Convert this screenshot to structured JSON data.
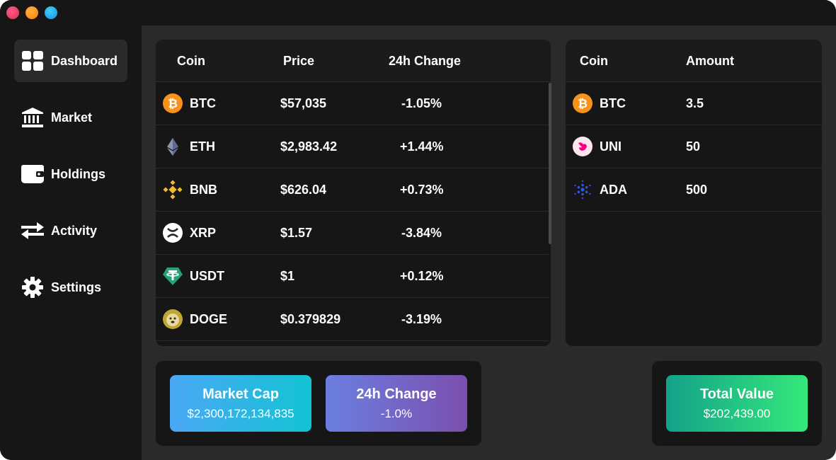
{
  "sidebar": {
    "items": [
      {
        "label": "Dashboard",
        "icon": "dashboard-grid-icon",
        "active": true
      },
      {
        "label": "Market",
        "icon": "bank-icon",
        "active": false
      },
      {
        "label": "Holdings",
        "icon": "wallet-icon",
        "active": false
      },
      {
        "label": "Activity",
        "icon": "swap-arrows-icon",
        "active": false
      },
      {
        "label": "Settings",
        "icon": "gear-icon",
        "active": false
      }
    ]
  },
  "market_table": {
    "headers": {
      "coin": "Coin",
      "price": "Price",
      "change": "24h Change"
    },
    "rows": [
      {
        "symbol": "BTC",
        "price": "$57,035",
        "change": "-1.05%",
        "icon": "bitcoin-icon",
        "color": "#f7931a"
      },
      {
        "symbol": "ETH",
        "price": "$2,983.42",
        "change": "+1.44%",
        "icon": "ethereum-icon",
        "color": "#627eea"
      },
      {
        "symbol": "BNB",
        "price": "$626.04",
        "change": "+0.73%",
        "icon": "bnb-icon",
        "color": "#f3ba2f"
      },
      {
        "symbol": "XRP",
        "price": "$1.57",
        "change": "-3.84%",
        "icon": "xrp-icon",
        "color": "#ffffff"
      },
      {
        "symbol": "USDT",
        "price": "$1",
        "change": "+0.12%",
        "icon": "tether-icon",
        "color": "#26a17b"
      },
      {
        "symbol": "DOGE",
        "price": "$0.379829",
        "change": "-3.19%",
        "icon": "dogecoin-icon",
        "color": "#c2a633"
      }
    ]
  },
  "holdings_table": {
    "headers": {
      "coin": "Coin",
      "amount": "Amount"
    },
    "rows": [
      {
        "symbol": "BTC",
        "amount": "3.5",
        "icon": "bitcoin-icon",
        "color": "#f7931a"
      },
      {
        "symbol": "UNI",
        "amount": "50",
        "icon": "uniswap-icon",
        "color": "#ff007a"
      },
      {
        "symbol": "ADA",
        "amount": "500",
        "icon": "cardano-icon",
        "color": "#0033ad"
      }
    ]
  },
  "stats": {
    "market_cap": {
      "title": "Market Cap",
      "value": "$2,300,172,134,835"
    },
    "change_24h": {
      "title": "24h Change",
      "value": "-1.0%"
    },
    "total_value": {
      "title": "Total Value",
      "value": "$202,439.00"
    }
  }
}
